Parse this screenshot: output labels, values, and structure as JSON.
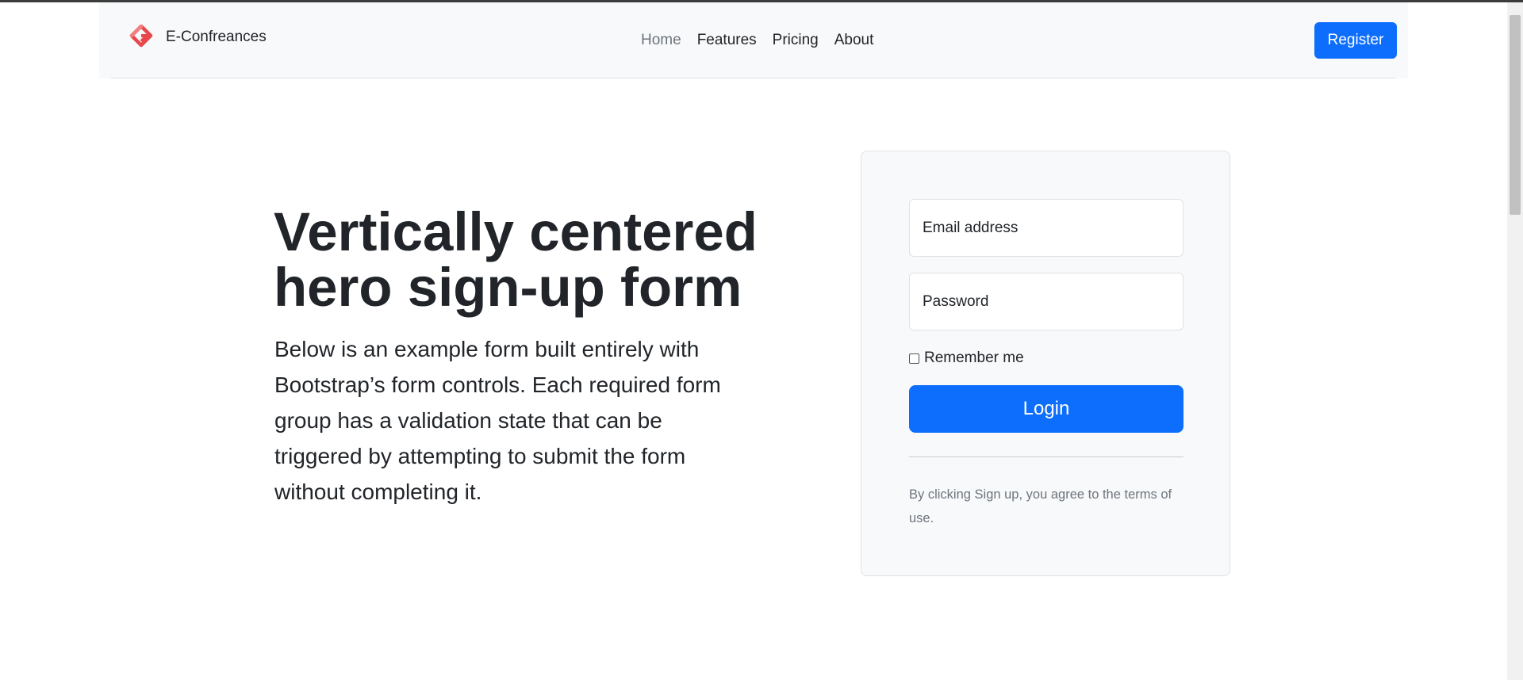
{
  "navbar": {
    "brand_name": "E-Confreances",
    "brand_logo": "brand-logo-icon",
    "links": [
      {
        "label": "Home",
        "active": true
      },
      {
        "label": "Features",
        "active": false
      },
      {
        "label": "Pricing",
        "active": false
      },
      {
        "label": "About",
        "active": false
      }
    ],
    "register_label": "Register"
  },
  "hero": {
    "title": "Vertically centered hero sign-up form",
    "lead": "Below is an example form built entirely with Bootstrap’s form controls. Each required form group has a validation state that can be triggered by attempting to submit the form without completing it."
  },
  "form": {
    "email_label": "Email address",
    "password_label": "Password",
    "remember_label": "Remember me",
    "remember_checked": false,
    "login_label": "Login",
    "terms": "By clicking Sign up, you agree to the terms of use."
  },
  "colors": {
    "primary": "#0d6efd",
    "navbar_bg": "#f8f9fa",
    "muted": "#6c757d",
    "logo": "#e8474c"
  }
}
